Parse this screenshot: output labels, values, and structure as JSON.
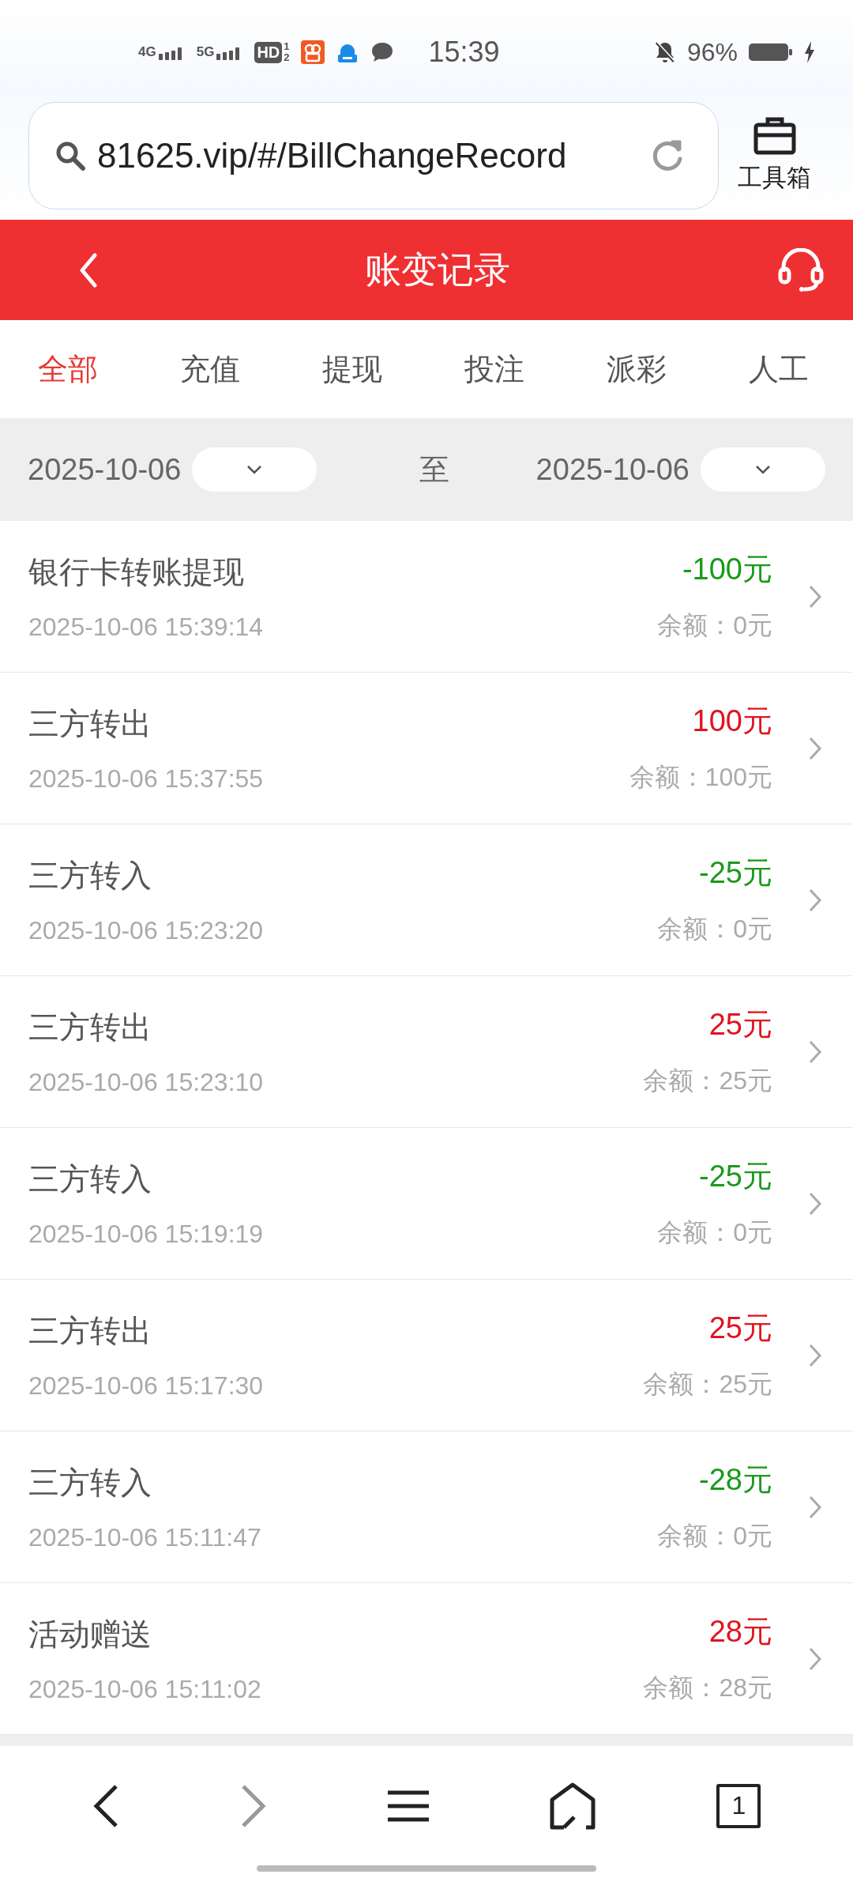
{
  "status_bar": {
    "networks": [
      "4G",
      "5G"
    ],
    "hd": "HD",
    "hd_sub": [
      "1",
      "2"
    ],
    "time": "15:39",
    "battery": "96%"
  },
  "browser": {
    "url": "81625.vip/#/BillChangeRecord",
    "toolbox_label": "工具箱"
  },
  "header": {
    "title": "账变记录"
  },
  "tabs": [
    {
      "label": "全部",
      "selected": true
    },
    {
      "label": "充值",
      "selected": false
    },
    {
      "label": "提现",
      "selected": false
    },
    {
      "label": "投注",
      "selected": false
    },
    {
      "label": "派彩",
      "selected": false
    },
    {
      "label": "人工",
      "selected": false
    }
  ],
  "date_filter": {
    "start": "2025-10-06",
    "separator": "至",
    "end": "2025-10-06"
  },
  "records": [
    {
      "title": "银行卡转账提现",
      "time": "2025-10-06 15:39:14",
      "amount": "-100元",
      "color": "#1a9a1a",
      "balance": "余额：0元"
    },
    {
      "title": "三方转出",
      "time": "2025-10-06 15:37:55",
      "amount": "100元",
      "color": "#e0141e",
      "balance": "余额：100元"
    },
    {
      "title": "三方转入",
      "time": "2025-10-06 15:23:20",
      "amount": "-25元",
      "color": "#1a9a1a",
      "balance": "余额：0元"
    },
    {
      "title": "三方转出",
      "time": "2025-10-06 15:23:10",
      "amount": "25元",
      "color": "#e0141e",
      "balance": "余额：25元"
    },
    {
      "title": "三方转入",
      "time": "2025-10-06 15:19:19",
      "amount": "-25元",
      "color": "#1a9a1a",
      "balance": "余额：0元"
    },
    {
      "title": "三方转出",
      "time": "2025-10-06 15:17:30",
      "amount": "25元",
      "color": "#e0141e",
      "balance": "余额：25元"
    },
    {
      "title": "三方转入",
      "time": "2025-10-06 15:11:47",
      "amount": "-28元",
      "color": "#1a9a1a",
      "balance": "余额：0元"
    },
    {
      "title": "活动赠送",
      "time": "2025-10-06 15:11:02",
      "amount": "28元",
      "color": "#e0141e",
      "balance": "余额：28元"
    }
  ],
  "bottom_nav": {
    "tab_count": "1"
  }
}
